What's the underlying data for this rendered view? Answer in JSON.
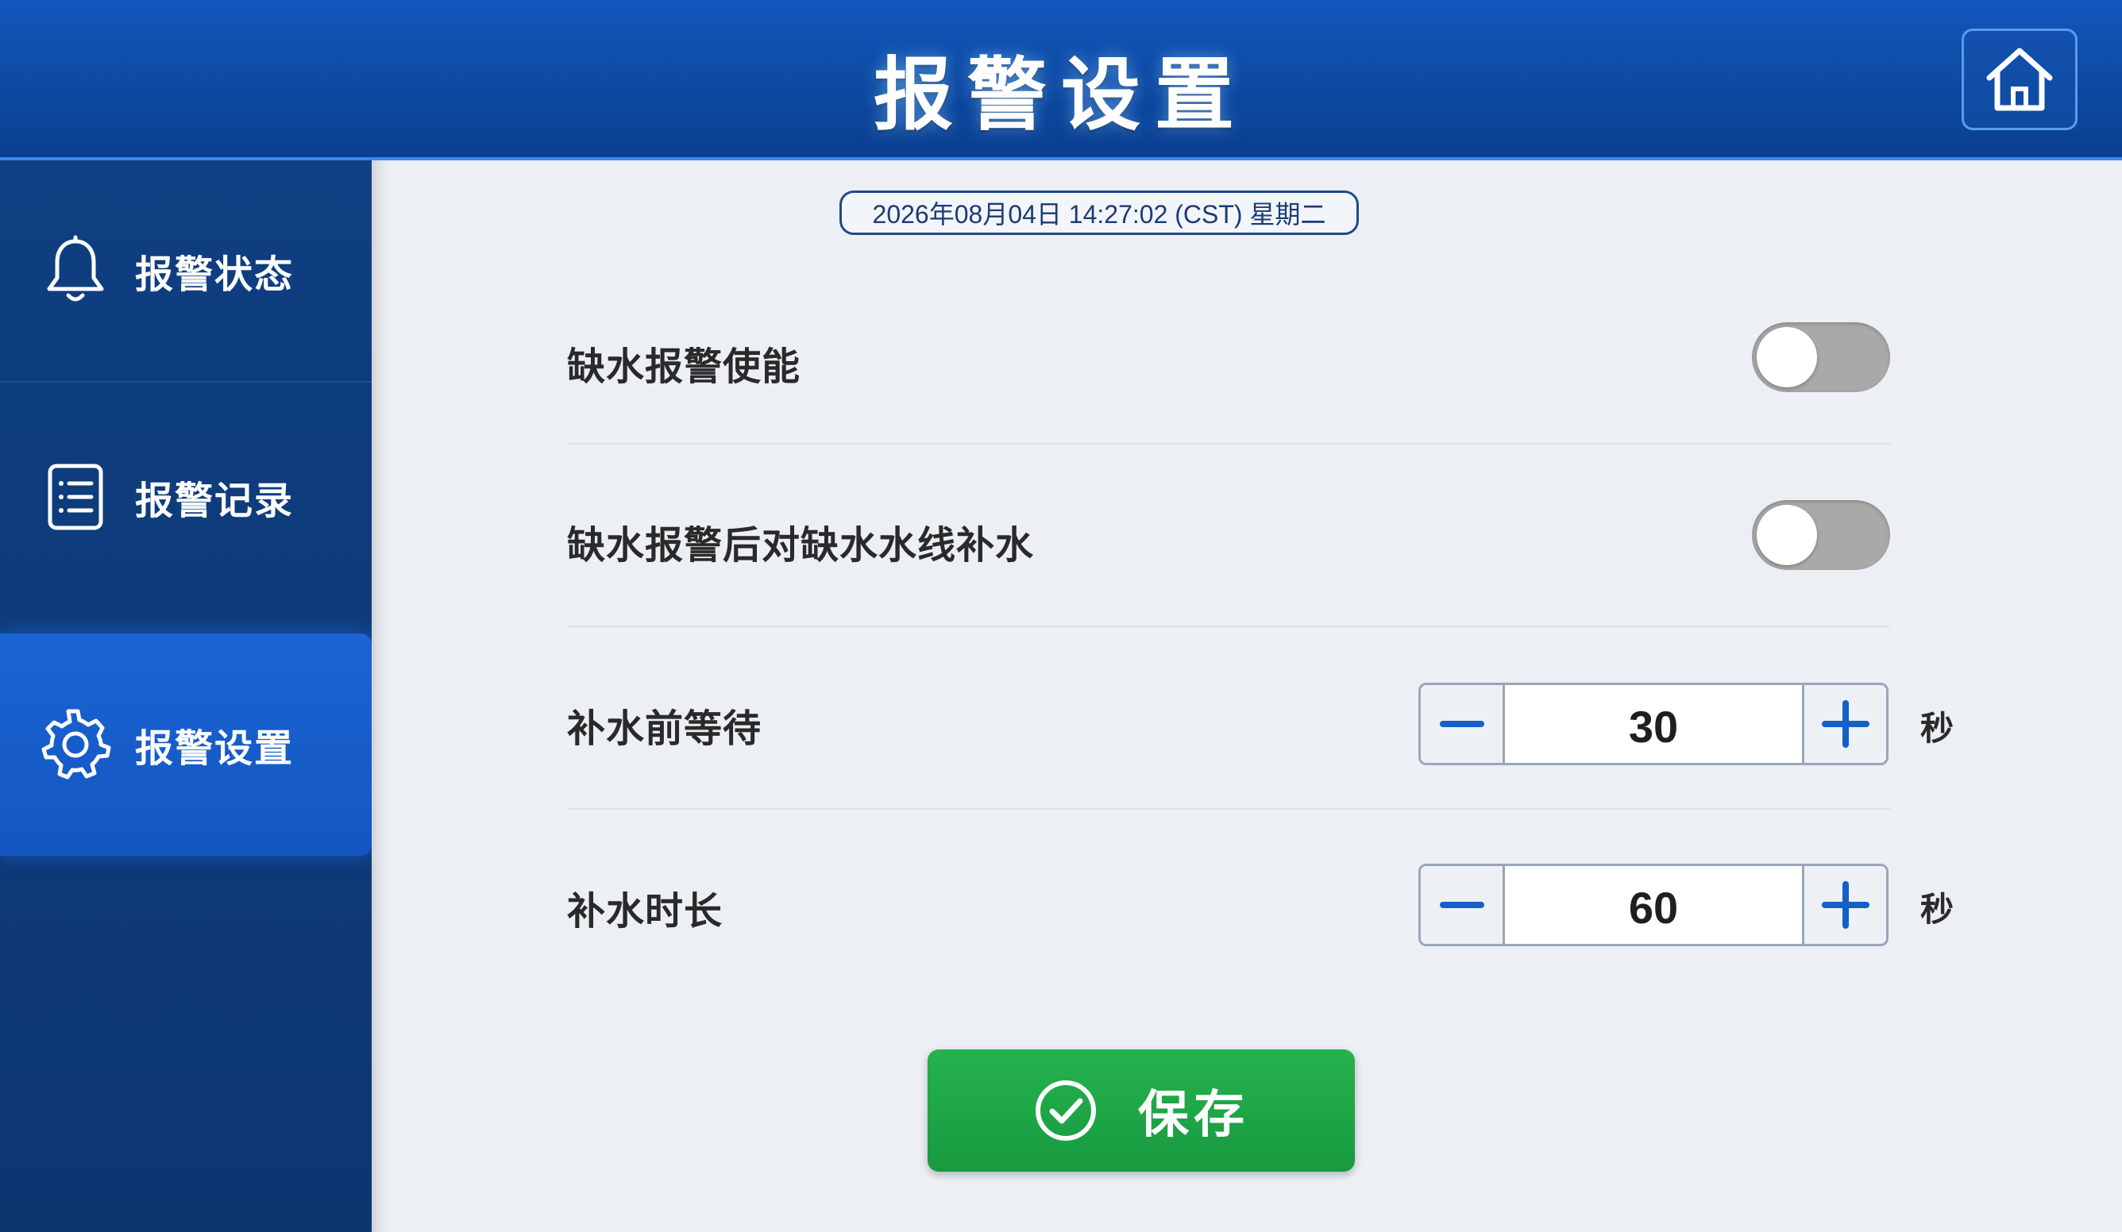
{
  "header": {
    "title": "报警设置",
    "home_icon": "home-icon"
  },
  "sidebar": {
    "items": [
      {
        "label": "报警状态",
        "icon": "bell-icon",
        "active": false
      },
      {
        "label": "报警记录",
        "icon": "list-document-icon",
        "active": false
      },
      {
        "label": "报警设置",
        "icon": "gear-icon",
        "active": true
      }
    ]
  },
  "main": {
    "datetime": "2026年08月04日 14:27:02 (CST) 星期二",
    "settings": [
      {
        "label": "缺水报警使能",
        "type": "toggle",
        "on": false
      },
      {
        "label": "缺水报警后对缺水水线补水",
        "type": "toggle",
        "on": false
      },
      {
        "label": "补水前等待",
        "type": "stepper",
        "value": "30",
        "unit": "秒"
      },
      {
        "label": "补水时长",
        "type": "stepper",
        "value": "60",
        "unit": "秒"
      }
    ],
    "save_label": "保存"
  },
  "colors": {
    "header": "#0d4aa3",
    "sidebar": "#0f3f82",
    "sidebar_active": "#1a64d4",
    "save_button": "#1fa646",
    "toggle_off": "#a9a9a9",
    "stepper_icon": "#1460c8"
  }
}
